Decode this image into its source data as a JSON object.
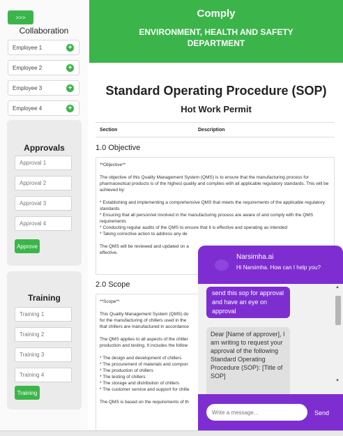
{
  "sidebar": {
    "toggle_label": ">>>",
    "collaboration_title": "Collaboration",
    "employees": [
      "Employee 1",
      "Employee 2",
      "Employee 3",
      "Employee 4"
    ],
    "approvals": {
      "title": "Approvals",
      "fields": [
        "Approval 1",
        "Approval 2",
        "Approval 3",
        "Approval 4"
      ],
      "button": "Approve"
    },
    "training": {
      "title": "Training",
      "fields": [
        "Training 1",
        "Training 2",
        "Training 3",
        "Training 4"
      ],
      "button": "Training"
    }
  },
  "header": {
    "brand": "Comply",
    "department": "ENVIRONMENT, HEALTH AND SAFETY DEPARTMENT"
  },
  "document": {
    "title": "Standard Operating Procedure (SOP)",
    "subtitle": "Hot Work Permit",
    "table_headers": [
      "Section",
      "Description"
    ],
    "sections": [
      {
        "heading": "1.0 Objective",
        "label": "**Objective**",
        "paragraphs": [
          "The objective of this Quality Management System (QMS) is to ensure that the manufacturing process for pharmaceutical products is of the highest quality and complies with all applicable regulatory standards. This will be achieved by:",
          "* Establishing and implementing a comprehensive QMS that meets the requirements of the applicable regulatory standards",
          "* Ensuring that all personnel involved in the manufacturing process are aware of and comply with the QMS requirements",
          "* Conducting regular audits of the QMS to ensure that it is effective and operating as intended",
          "* Taking corrective action to address any de",
          "The QMS will be reviewed and updated on a",
          "effective."
        ]
      },
      {
        "heading": "2.0 Scope",
        "label": "**Scope**",
        "paragraphs": [
          "This Quality Management System (QMS) do",
          "for the manufacturing of chillers used in the",
          "that chillers are manufactured in accordance",
          "The QMS applies to all aspects of the chiller",
          "production and testing. It includes the follow",
          "* The design and development of chillers",
          "* The procurement of materials and compon",
          "* The production of chillers",
          "* The testing of chillers",
          "* The storage and distribution of chillers",
          "* The customer service and support for chille",
          "The QMS is based on the requirements of th"
        ]
      }
    ]
  },
  "chat": {
    "bot_name": "Narsimha.ai",
    "greeting": "Hi Narsimha. How can I help you?",
    "user_message": "send this sop for approval and have an eye on approval",
    "bot_message": "Dear [Name of approver], I am writing to request your approval of the following Standard Operating Procedure (SOP): [Title of SOP]",
    "input_placeholder": "Write a message...",
    "send_label": "Send",
    "scroll_up_icon": "▲",
    "scroll_down_icon": "▼"
  },
  "colors": {
    "brand_green": "#3bb54a",
    "chat_purple": "#7e2ed0"
  }
}
